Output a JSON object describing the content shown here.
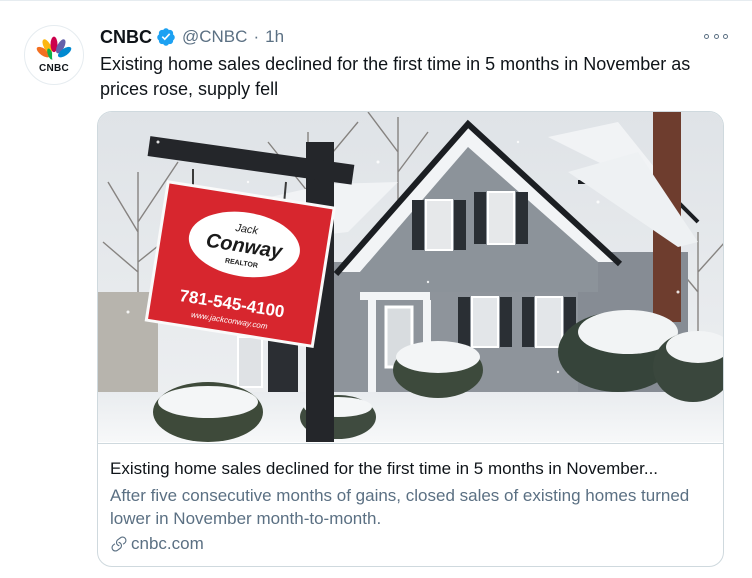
{
  "tweet": {
    "author_name": "CNBC",
    "handle": "@CNBC",
    "separator": "·",
    "time": "1h",
    "text": "Existing home sales declined for the first time in 5 months in November as prices rose, supply fell",
    "avatar_logo_text": "CNBC",
    "icons": [
      "verified-badge-icon",
      "more-options-icon",
      "link-icon"
    ]
  },
  "card": {
    "title": "Existing home sales declined for the first time in 5 months in November...",
    "description": "After five consecutive months of gains, closed sales of existing homes turned lower in November month-to-month.",
    "domain": "cnbc.com",
    "image_sign": {
      "brand_top": "Jack",
      "brand_main": "Conway",
      "brand_sub": "REALTOR",
      "phone": "781-545-4100",
      "web": "www.jackconway.com"
    }
  },
  "colors": {
    "text_primary": "#0f1419",
    "text_secondary": "#5b7083",
    "verified": "#1da1f2",
    "border": "#cfd9de",
    "sign_red": "#d7262e"
  }
}
